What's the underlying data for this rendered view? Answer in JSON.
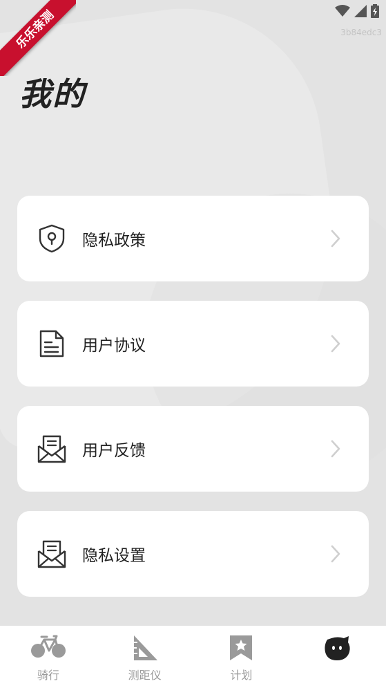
{
  "ribbon": {
    "text": "乐乐亲测"
  },
  "status": {
    "build_id": "3b84edc3"
  },
  "page": {
    "title": "我的"
  },
  "menu": [
    {
      "label": "隐私政策",
      "icon": "shield-lock-icon"
    },
    {
      "label": "用户协议",
      "icon": "document-icon"
    },
    {
      "label": "用户反馈",
      "icon": "mail-open-icon"
    },
    {
      "label": "隐私设置",
      "icon": "mail-open-icon"
    }
  ],
  "tabs": [
    {
      "label": "骑行",
      "icon": "bicycle-icon"
    },
    {
      "label": "测距仪",
      "icon": "ruler-triangle-icon"
    },
    {
      "label": "计划",
      "icon": "bookmark-star-icon"
    },
    {
      "label": "",
      "icon": "mascot-icon",
      "active": true
    }
  ],
  "colors": {
    "ribbon": "#c8102e",
    "background": "#e3e3e3",
    "card": "#ffffff",
    "tab_inactive": "#9a9a9a"
  }
}
